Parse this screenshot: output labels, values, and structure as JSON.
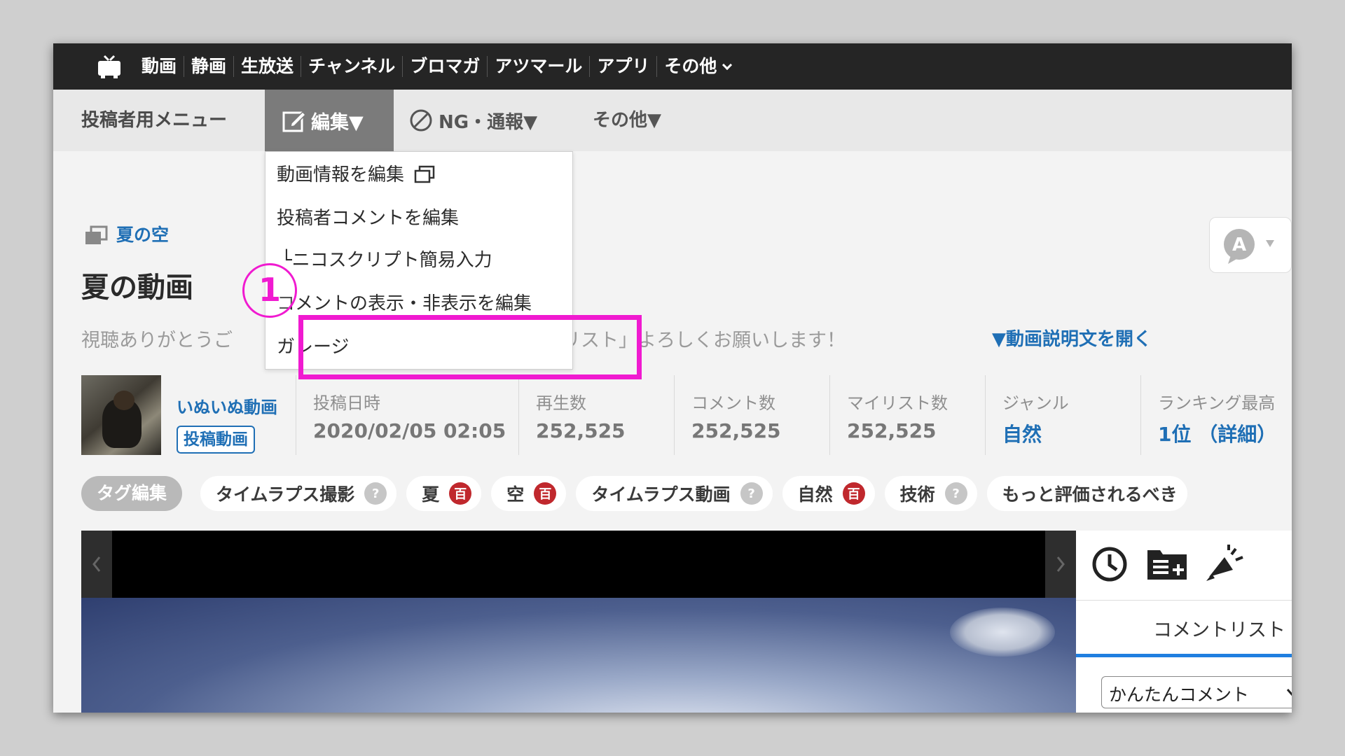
{
  "site_nav": {
    "items": [
      "動画",
      "静画",
      "生放送",
      "チャンネル",
      "ブロマガ",
      "アツマール",
      "アプリ",
      "その他"
    ]
  },
  "owner_menu": {
    "label": "投稿者用メニュー",
    "edit_tab": "編集▼",
    "ng_tab": "NG・通報▼",
    "other_tab": "その他▼"
  },
  "edit_dropdown": {
    "items": [
      "動画情報を編集",
      "投稿者コメントを編集",
      "└ニコスクリプト簡易入力",
      "コメントの表示・非表示を編集",
      "ガレージ"
    ]
  },
  "video": {
    "series": "夏の空",
    "title": "夏の動画",
    "description": "視聴ありがとうご",
    "description_tail": "リスト」よろしくお願いします！",
    "open_description": "▼動画説明文を開く"
  },
  "uploader": {
    "name": "いぬいぬ動画",
    "badge": "投稿動画"
  },
  "stats": [
    {
      "label": "投稿日時",
      "value": "2020/02/05 02:05"
    },
    {
      "label": "再生数",
      "value": "252,525"
    },
    {
      "label": "コメント数",
      "value": "252,525"
    },
    {
      "label": "マイリスト数",
      "value": "252,525"
    },
    {
      "label": "ジャンル",
      "value": "自然"
    },
    {
      "label": "ランキング最高",
      "value": "1位 （詳細）"
    }
  ],
  "tags": {
    "edit_label": "タグ編集",
    "items": [
      {
        "name": "タイムラプス撮影",
        "icon": "?"
      },
      {
        "name": "夏",
        "icon": "百"
      },
      {
        "name": "空",
        "icon": "百"
      },
      {
        "name": "タイムラプス動画",
        "icon": "?"
      },
      {
        "name": "自然",
        "icon": "百"
      },
      {
        "name": "技術",
        "icon": "?"
      },
      {
        "name": "もっと評価されるべき",
        "icon": ""
      }
    ]
  },
  "side_panel": {
    "tab_label": "コメントリスト",
    "select_value": "かんたんコメント"
  },
  "annotation": {
    "step_marker": "1"
  },
  "colors": {
    "highlight": "#f01ad0",
    "link": "#1f6fb5",
    "top_bar": "#252525"
  }
}
